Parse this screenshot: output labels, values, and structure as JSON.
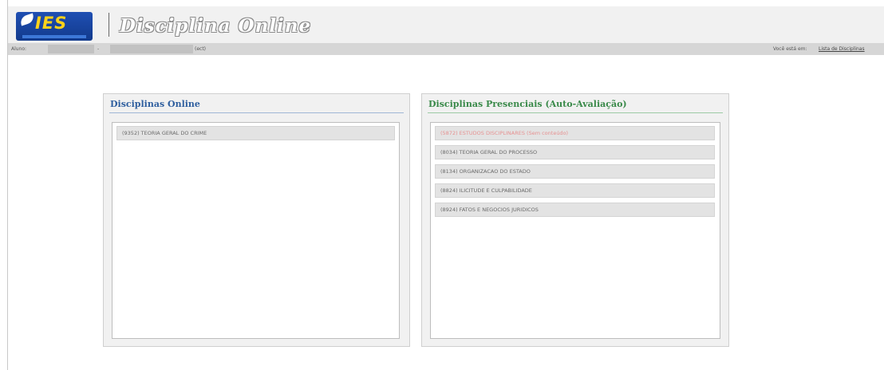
{
  "header": {
    "logo_text": "IES",
    "app_title": "Disciplina Online"
  },
  "userbar": {
    "student_label": "Aluno:",
    "separator": "-",
    "code_suffix": "(ect)",
    "location_label": "Você está em:",
    "location_link": "Lista de Disciplinas"
  },
  "online_panel": {
    "title": "Disciplinas Online",
    "items": [
      {
        "label": "(9352) TEORIA GERAL DO CRIME"
      }
    ]
  },
  "presencial_panel": {
    "title": "Disciplinas Presenciais (Auto-Avaliação)",
    "items": [
      {
        "label": "(5872) ESTUDOS DISCIPLINARES (Sem conteúdo)",
        "highlight": true
      },
      {
        "label": "(8034) TEORIA GERAL DO PROCESSO"
      },
      {
        "label": "(8134) ORGANIZACAO DO ESTADO"
      },
      {
        "label": "(8824) ILICITUDE E CULPABILIDADE"
      },
      {
        "label": "(8924) FATOS E NEGOCIOS JURIDICOS"
      }
    ]
  },
  "colors": {
    "online_title": "#2f5f9f",
    "presencial_title": "#3a8a4a",
    "highlight_item": "#e69090",
    "logo_blue": "#1f4fb3",
    "logo_yellow": "#ffd21a"
  }
}
